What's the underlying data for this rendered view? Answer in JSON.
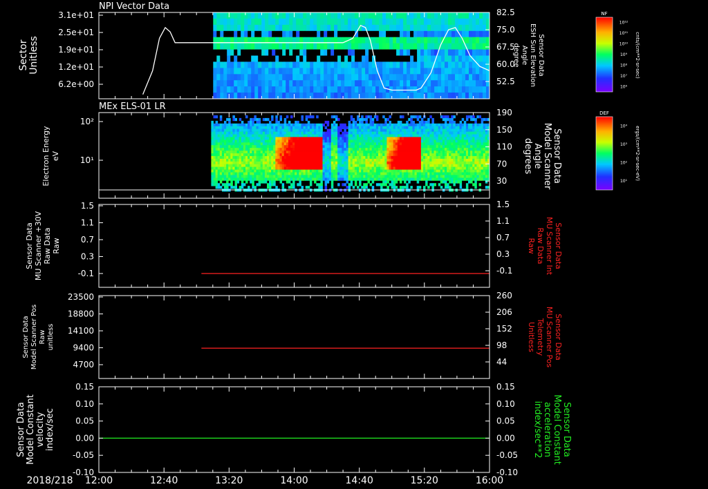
{
  "colors": {
    "background": "#000000",
    "foreground": "#ffffff",
    "red_series": "#ff2222",
    "green_series": "#22ee22"
  },
  "time_axis": {
    "date_label": "2018/218",
    "ticks": [
      "12:00",
      "12:40",
      "13:20",
      "14:00",
      "14:40",
      "15:20",
      "16:00"
    ],
    "tick_hours": [
      12.0,
      12.6667,
      13.3333,
      14.0,
      14.6667,
      15.3333,
      16.0
    ],
    "range_hours": [
      12.0,
      16.0
    ]
  },
  "chart_data": [
    {
      "type": "heatmap",
      "title": "NPI Vector Data",
      "ylabel": [
        "Sector",
        "Unitless"
      ],
      "yticks": [
        "3.1e+01",
        "2.5e+01",
        "1.9e+01",
        "1.2e+01",
        "6.2e+00"
      ],
      "y2label": [
        "Sensor Data",
        "ESH Sun Elevation",
        "Angle",
        "degree"
      ],
      "y2ticks": [
        "82.5",
        "75.0",
        "67.5",
        "60.0",
        "52.5"
      ],
      "colorbar": {
        "label": "NF",
        "units": "cnts/(cm**2-sr-sec)",
        "ticks": [
          "10¹²",
          "10¹¹",
          "10¹⁰",
          "10⁹",
          "10⁸",
          "10⁷",
          "10⁶"
        ]
      },
      "data_start_hour": 13.17,
      "overlay_line": {
        "name": "ESH Sun Elevation Angle",
        "x_hours": [
          12.45,
          12.55,
          12.62,
          12.68,
          12.73,
          12.78,
          13.0,
          13.5,
          14.0,
          14.5,
          14.6,
          14.68,
          14.73,
          14.78,
          14.85,
          14.92,
          15.0,
          15.25,
          15.3,
          15.4,
          15.5,
          15.58,
          15.65,
          15.72,
          15.8,
          15.9,
          16.0
        ],
        "y_degrees": [
          47,
          58,
          73,
          78,
          76,
          71,
          71,
          71,
          71,
          71,
          73,
          79,
          78,
          72,
          58,
          50,
          49,
          49,
          50,
          57,
          70,
          77,
          78,
          73,
          65,
          60,
          58
        ]
      }
    },
    {
      "type": "heatmap",
      "title": "MEx ELS-01 LR",
      "ylabel": [
        "Electron Energy",
        "eV"
      ],
      "yticks": [
        "10²",
        "10¹"
      ],
      "y2label": [
        "Sensor Data",
        "Model Scanner",
        "Angle",
        "degrees"
      ],
      "y2ticks": [
        "190",
        "150",
        "110",
        "70",
        "30"
      ],
      "colorbar": {
        "label": "DEF",
        "units": "ergs/(cm**2-sr-sec-eV)",
        "ticks": [
          "10⁴",
          "10³",
          "10²",
          "10¹"
        ]
      },
      "data_start_hour": 13.15,
      "intense_intervals_hours": [
        [
          13.8,
          14.3
        ],
        [
          14.95,
          15.3
        ]
      ]
    },
    {
      "type": "line",
      "ylabel": [
        "Sensor Data",
        "MU Scanner +30V",
        "Raw Data",
        "Raw"
      ],
      "yticks": [
        "1.5",
        "1.1",
        "0.7",
        "0.3",
        "-0.1"
      ],
      "ylim": [
        -0.3,
        1.5
      ],
      "y2label": [
        "Sensor Data",
        "MU Scanner Int",
        "Raw Data",
        "Raw"
      ],
      "y2ticks": [
        "1.5",
        "1.1",
        "0.7",
        "0.3",
        "-0.1"
      ],
      "series": [
        {
          "x_hours": [
            13.05,
            16.0
          ],
          "y": [
            0.0,
            0.0
          ]
        }
      ]
    },
    {
      "type": "line",
      "ylabel": [
        "Sensor Data",
        "Model Scanner Pos",
        "Raw",
        "unitless"
      ],
      "yticks": [
        "23500",
        "18800",
        "14100",
        "9400",
        "4700"
      ],
      "ylim": [
        0,
        23500
      ],
      "y2label": [
        "Sensor Data",
        "MU Scanner Pos",
        "Telemetry",
        "Unitless"
      ],
      "y2ticks": [
        "260",
        "206",
        "152",
        "98",
        "44"
      ],
      "series": [
        {
          "x_hours": [
            13.05,
            16.0
          ],
          "y": [
            8600,
            8600
          ]
        }
      ]
    },
    {
      "type": "line",
      "ylabel": [
        "Sensor Data",
        "Model Constant",
        "velocity",
        "index/sec"
      ],
      "yticks": [
        "0.15",
        "0.10",
        "0.05",
        "0.00",
        "-0.05",
        "-0.10"
      ],
      "ylim": [
        -0.1,
        0.15
      ],
      "y2label": [
        "Sensor Data",
        "Model Constant",
        "acceleration",
        "index/sec**2"
      ],
      "y2ticks": [
        "0.15",
        "0.10",
        "0.05",
        "0.00",
        "-0.05",
        "-0.10"
      ],
      "series": [
        {
          "x_hours": [
            12.0,
            16.0
          ],
          "y": [
            0.0,
            0.0
          ]
        }
      ]
    }
  ]
}
